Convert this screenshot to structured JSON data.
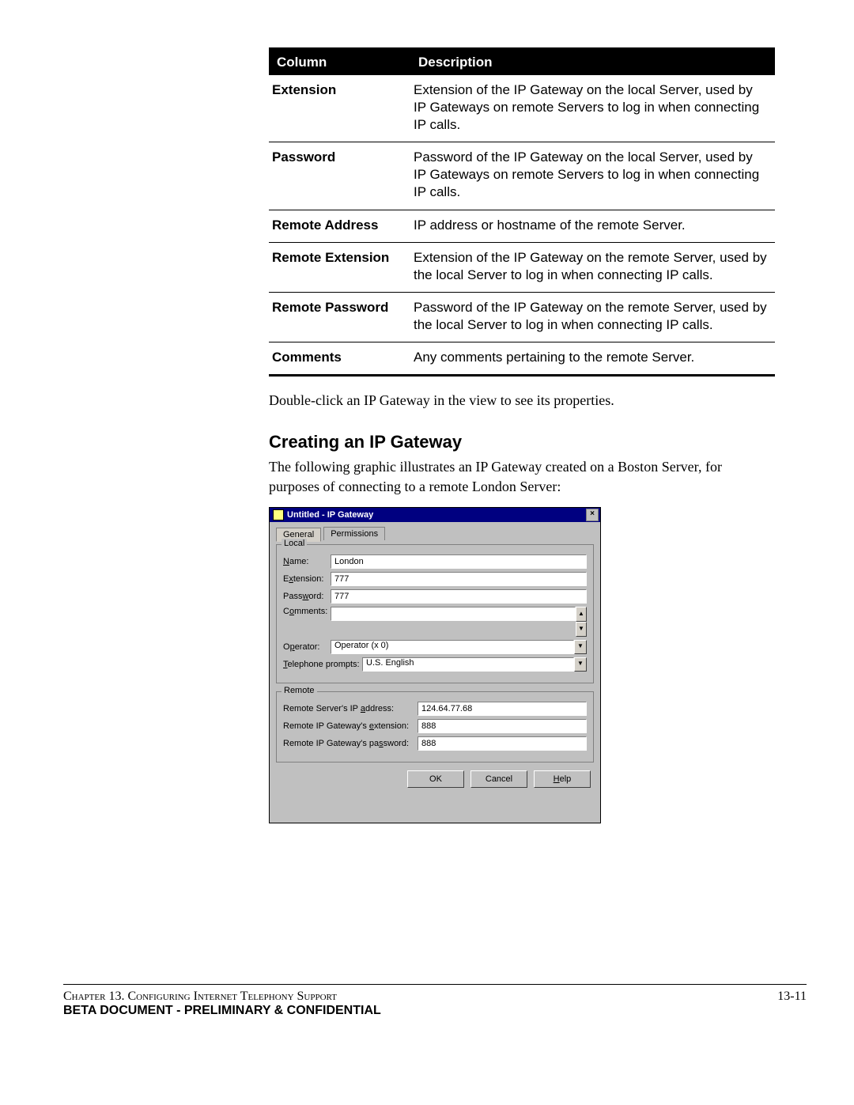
{
  "table": {
    "headers": {
      "c1": "Column",
      "c2": "Description"
    },
    "rows": [
      {
        "c1": "Extension",
        "c2": "Extension of the IP Gateway on the local Server, used by IP Gateways on remote Servers to log in when connecting IP calls."
      },
      {
        "c1": "Password",
        "c2": "Password of the IP Gateway on the local Server, used by IP Gateways on remote Servers to log in when connecting IP calls."
      },
      {
        "c1": "Remote Address",
        "c2": "IP address or hostname of the remote Server."
      },
      {
        "c1": "Remote Extension",
        "c2": "Extension of the IP Gateway on the remote Server, used by the local Server to log in when connecting IP calls."
      },
      {
        "c1": "Remote Password",
        "c2": "Password of the IP Gateway on the remote Server, used by the local Server to log in when connecting IP calls."
      },
      {
        "c1": "Comments",
        "c2": "Any comments pertaining to the remote Server."
      }
    ]
  },
  "body": {
    "after_table": "Double-click an IP Gateway in the view to see its properties.",
    "heading": "Creating an IP Gateway",
    "intro": "The following graphic illustrates an IP Gateway created on a Boston Server, for purposes of connecting to a remote London Server:"
  },
  "dialog": {
    "title": "Untitled - IP Gateway",
    "tabs": {
      "general": "General",
      "permissions": "Permissions"
    },
    "local": {
      "legend": "Local",
      "name_label": "Name:",
      "name_value": "London",
      "ext_label": "Extension:",
      "ext_value": "777",
      "pwd_label": "Password:",
      "pwd_value": "777",
      "comments_label": "Comments:",
      "comments_value": "",
      "operator_label": "Operator:",
      "operator_value": "Operator (x 0)",
      "prompts_label": "Telephone prompts:",
      "prompts_value": "U.S. English"
    },
    "remote": {
      "legend": "Remote",
      "addr_label": "Remote Server's IP address:",
      "addr_value": "124.64.77.68",
      "ext_label": "Remote IP Gateway's extension:",
      "ext_value": "888",
      "pwd_label": "Remote IP Gateway's password:",
      "pwd_value": "888"
    },
    "buttons": {
      "ok": "OK",
      "cancel": "Cancel",
      "help": "Help"
    }
  },
  "footer": {
    "chapter": "Chapter 13. Configuring Internet Telephony Support",
    "page": "13-11",
    "banner": "BETA DOCUMENT - PRELIMINARY & CONFIDENTIAL"
  }
}
